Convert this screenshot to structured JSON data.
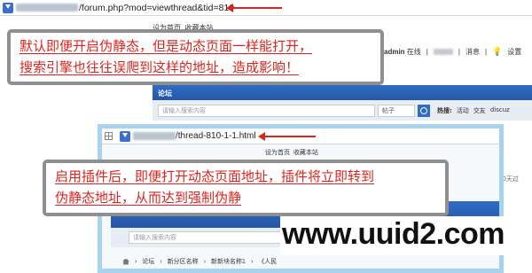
{
  "back_page": {
    "url_path": "/forum.php?mod=viewthread&tid=810",
    "topnav": [
      "设为首页",
      "收藏本站"
    ],
    "user": {
      "name": "admin",
      "status": "在线",
      "messages": "消息",
      "settings": "设置"
    },
    "forum_bar_label": "论坛",
    "search": {
      "placeholder": "请输入搜索内容",
      "type_value": "帖子"
    },
    "hot": {
      "label": "热搜:",
      "items": [
        "活动",
        "交友",
        "discuz"
      ]
    },
    "sidenote": "10天过"
  },
  "front_page": {
    "url_path": "/thread-810-1-1.html",
    "topnav": [
      "设为首页",
      "收藏本站"
    ],
    "search": {
      "placeholder": "请输入搜索内容"
    },
    "breadcrumb": [
      "论坛",
      "新分区名称",
      "新新块名称1",
      "《人民"
    ]
  },
  "callouts": {
    "first": [
      "默认即便开启伪静态，但是动态页面一样能打开，",
      "搜索引擎也往往误爬到这样的地址，造成影响！"
    ],
    "second": [
      "启用插件后，即便打开动态页面地址，插件将立即转到",
      "伪静态地址，从而达到强制伪静"
    ]
  },
  "watermark": "www.uuid2.com",
  "colors": {
    "accent_red": "#d9251f",
    "forum_blue": "#2f6cc4",
    "frame_blue": "#a8d3ee"
  }
}
